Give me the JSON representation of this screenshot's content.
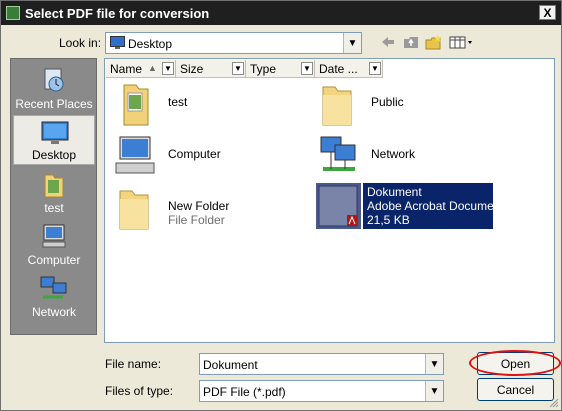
{
  "dialog": {
    "title": "Select PDF file for conversion",
    "close_glyph": "X"
  },
  "lookin": {
    "label": "Look in:",
    "value": "Desktop"
  },
  "toolbar": {
    "icons": [
      "back-arrow-icon",
      "up-folder-icon",
      "new-folder-icon",
      "view-menu-icon"
    ]
  },
  "places": [
    {
      "label": "Recent Places",
      "icon": "recent-places-icon",
      "selected": false
    },
    {
      "label": "Desktop",
      "icon": "desktop-icon",
      "selected": true
    },
    {
      "label": "test",
      "icon": "folder-icon",
      "selected": false
    },
    {
      "label": "Computer",
      "icon": "computer-icon",
      "selected": false
    },
    {
      "label": "Network",
      "icon": "network-icon",
      "selected": false
    }
  ],
  "columns": [
    {
      "label": "Name",
      "sort_glyph": "▲"
    },
    {
      "label": "Size"
    },
    {
      "label": "Type"
    },
    {
      "label": "Date ..."
    }
  ],
  "files": [
    {
      "name": "test",
      "icon": "folder-with-files-icon"
    },
    {
      "name": "Public",
      "icon": "folder-icon"
    },
    {
      "name": "Computer",
      "icon": "computer-icon"
    },
    {
      "name": "Network",
      "icon": "network-icon"
    },
    {
      "name": "New Folder",
      "subtitle": "File Folder",
      "icon": "folder-icon"
    },
    {
      "name": "Dokument",
      "type": "Adobe Acrobat Document",
      "size": "21,5 KB",
      "icon": "pdf-document-icon",
      "selected": true
    }
  ],
  "filename": {
    "label": "File name:",
    "value": "Dokument"
  },
  "filetype": {
    "label": "Files of type:",
    "value": "PDF File (*.pdf)"
  },
  "buttons": {
    "open": "Open",
    "cancel": "Cancel"
  },
  "colors": {
    "selection": "#0a246a",
    "sidebar": "#8a8a8a",
    "highlight_ring": "#dd1111"
  }
}
